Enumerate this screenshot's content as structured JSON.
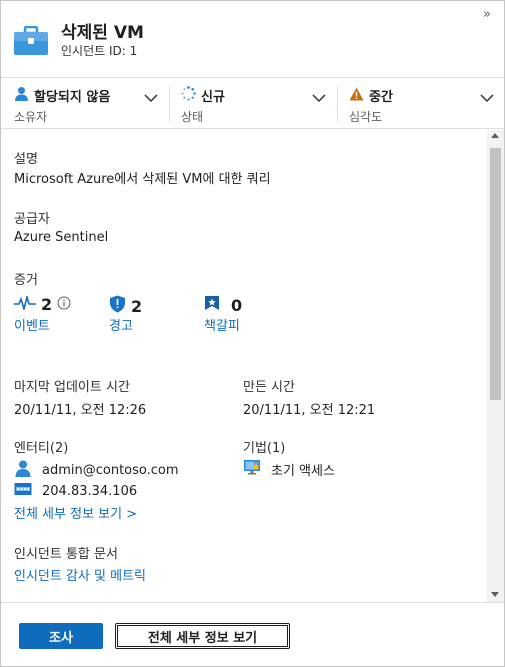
{
  "header": {
    "title": "삭제된 VM",
    "subtitle": "인시던트 ID: 1",
    "collapse_glyph": "»"
  },
  "status": {
    "owner": {
      "value": "할당되지 않음",
      "label": "소유자"
    },
    "state": {
      "value": "신규",
      "label": "상태"
    },
    "severity": {
      "value": "중간",
      "label": "심각도"
    }
  },
  "description": {
    "label": "설명",
    "value": "Microsoft Azure에서 삭제된 VM에 대한 쿼리"
  },
  "provider": {
    "label": "공급자",
    "value": "Azure Sentinel"
  },
  "evidence": {
    "label": "증거",
    "events": {
      "count": "2",
      "label": "이벤트"
    },
    "alerts": {
      "count": "2",
      "label": "경고"
    },
    "bookmarks": {
      "count": "0",
      "label": "책갈피"
    }
  },
  "times": {
    "last_update_label": "마지막 업데이트 시간",
    "last_update_value": "20/11/11, 오전 12:26",
    "created_label": "만든 시간",
    "created_value": "20/11/11, 오전 12:21"
  },
  "entities": {
    "label": "엔터티(2)",
    "items": [
      "admin@contoso.com",
      "204.83.34.106"
    ],
    "view_all": "전체 세부 정보 보기 >"
  },
  "tactics": {
    "label": "기법(1)",
    "items": [
      "초기 액세스"
    ]
  },
  "workbook": {
    "label": "인시던트 통합 문서",
    "link": "인시던트 감사 및 메트릭"
  },
  "footer": {
    "investigate": "조사",
    "view_full": "전체 세부 정보 보기"
  },
  "colors": {
    "accent": "#0f6cbd",
    "severity_medium": "#c8700a",
    "owner_icon": "#2b88d8",
    "alert_shield": "#1a73c7"
  },
  "icons": {
    "incident": "briefcase-icon",
    "owner": "person-icon",
    "state": "spinner-icon",
    "severity": "warning-icon",
    "events": "pulse-icon",
    "alerts": "shield-icon",
    "bookmarks": "bookmark-icon",
    "user_entity": "user-icon",
    "ip_entity": "ip-address-icon",
    "tactic": "monitor-lock-icon"
  }
}
